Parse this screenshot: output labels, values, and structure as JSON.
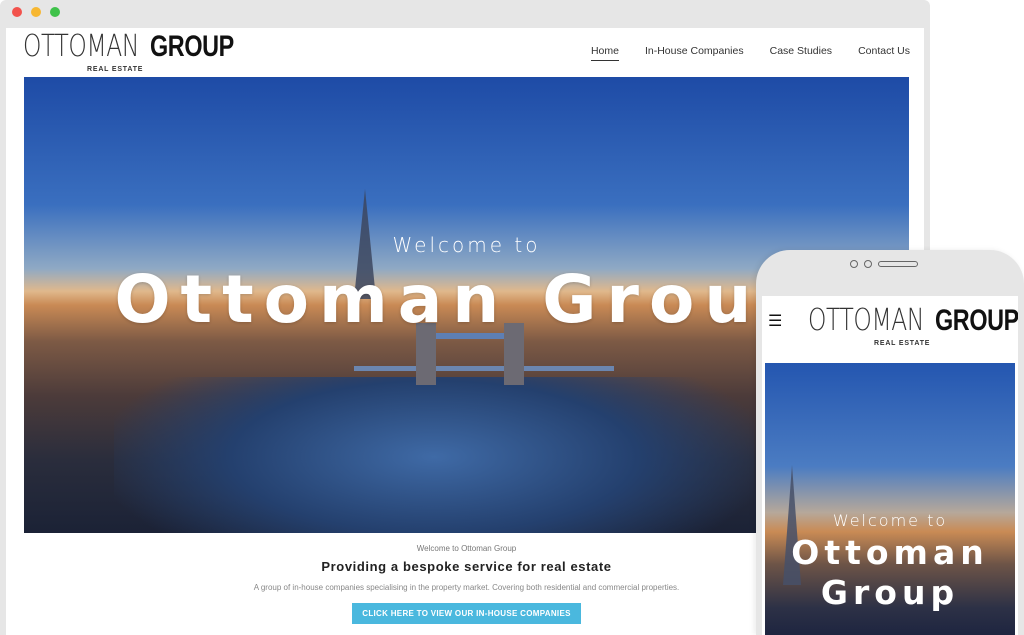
{
  "desktop": {
    "logo": {
      "thin": "OTTOMAN",
      "bold": "GROUP",
      "sub": "REAL ESTATE"
    },
    "nav": [
      {
        "label": "Home",
        "active": true
      },
      {
        "label": "In-House Companies",
        "active": false
      },
      {
        "label": "Case Studies",
        "active": false
      },
      {
        "label": "Contact Us",
        "active": false
      }
    ],
    "hero": {
      "welcome": "Welcome to",
      "title": "Ottoman Group"
    },
    "content": {
      "eyebrow": "Welcome to Ottoman Group",
      "heading": "Providing a bespoke service for real estate",
      "body": "A group of in-house companies specialising in the property market. Covering both residential and commercial properties.",
      "cta": "CLICK HERE TO VIEW OUR IN-HOUSE COMPANIES"
    }
  },
  "mobile": {
    "menu_icon": "hamburger-icon",
    "logo": {
      "thin": "OTTOMAN",
      "bold": "GROUP",
      "sub": "REAL ESTATE"
    },
    "hero": {
      "welcome": "Welcome to",
      "title_line1": "Ottoman",
      "title_line2": "Group"
    }
  },
  "colors": {
    "cta": "#4ab8de",
    "dot_red": "#f2524c",
    "dot_yellow": "#f7b731",
    "dot_green": "#3fc24a"
  }
}
